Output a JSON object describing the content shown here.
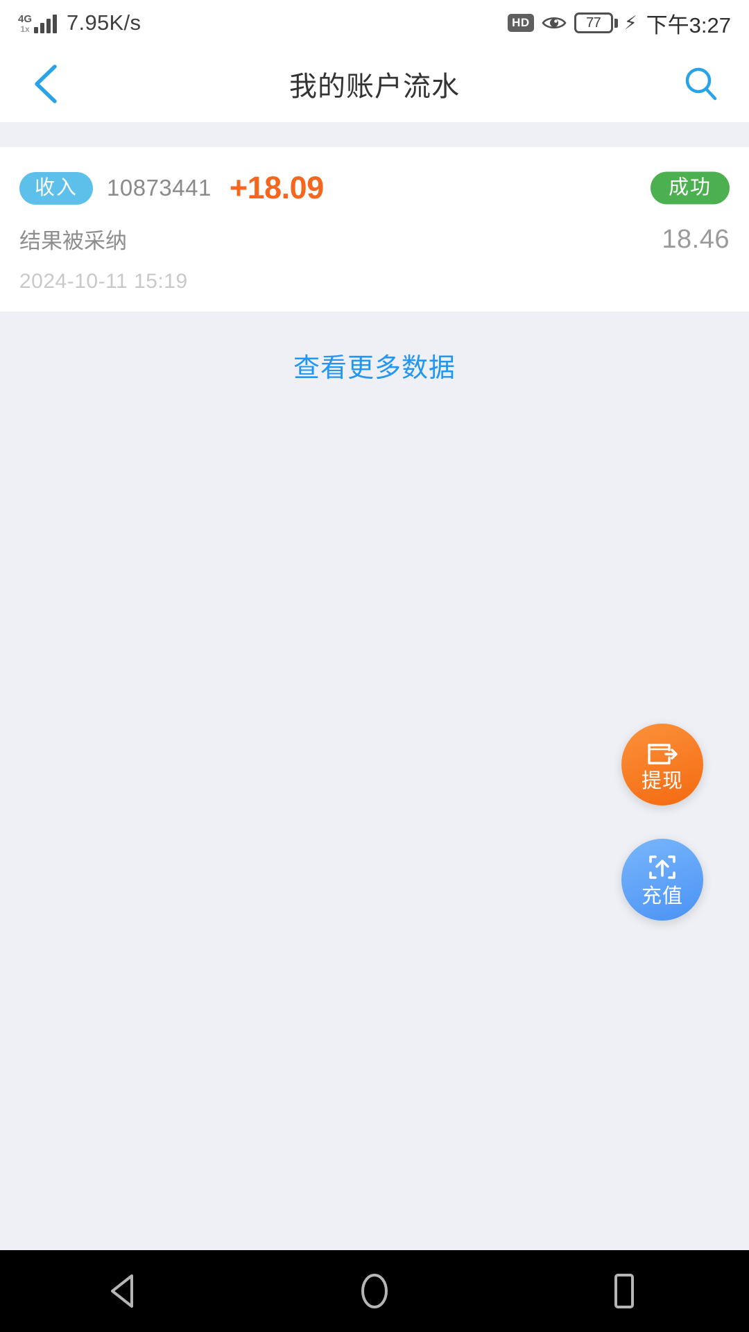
{
  "status_bar": {
    "network_type": "4G",
    "network_sub": "1x",
    "speed": "7.95K/s",
    "hd_label": "HD",
    "eye_icon": "eye-icon",
    "battery_level": "77",
    "charging_icon": "charging-bolt-icon",
    "time": "下午3:27"
  },
  "header": {
    "back_icon": "back-chevron-icon",
    "title": "我的账户流水",
    "search_icon": "search-icon",
    "accent_color": "#29a3e8"
  },
  "transaction": {
    "type_badge": "收入",
    "type_badge_color": "#5cc0ea",
    "id": "10873441",
    "amount": "+18.09",
    "amount_color": "#f5671f",
    "status_badge": "成功",
    "status_badge_color": "#4caf50",
    "description": "结果被采纳",
    "balance": "18.46",
    "datetime": "2024-10-11 15:19"
  },
  "more_link": {
    "label": "查看更多数据",
    "color": "#2196f3"
  },
  "fabs": [
    {
      "label": "提现",
      "icon": "wallet-withdraw-icon",
      "color": "#f4690f"
    },
    {
      "label": "充值",
      "icon": "upload-box-icon",
      "color": "#4a92f5"
    }
  ],
  "nav_bar": {
    "back": "triangle-back-icon",
    "home": "circle-home-icon",
    "recents": "square-recents-icon"
  }
}
